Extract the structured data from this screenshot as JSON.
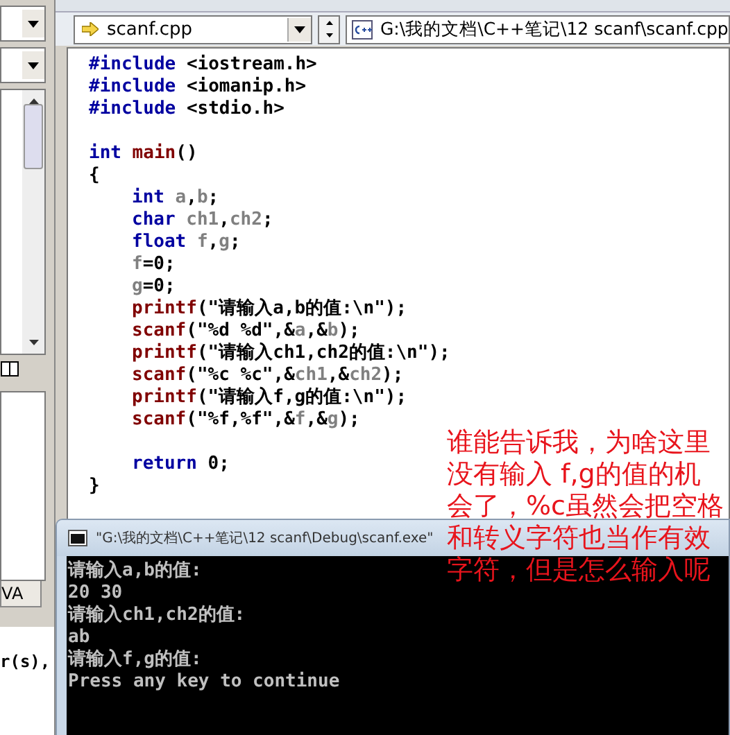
{
  "toolbar": {
    "file_combo": "scanf.cpp",
    "path": "G:\\我的文档\\C++笔记\\12 scanf\\scanf.cpp"
  },
  "editor": {
    "lines": [
      {
        "kind": "top",
        "tokens": [
          {
            "kind": "keyword",
            "text": "#include"
          },
          {
            "kind": "plain",
            "text": " <iostream.h>"
          }
        ]
      },
      {
        "kind": "top",
        "tokens": [
          {
            "kind": "keyword",
            "text": "#include"
          },
          {
            "kind": "plain",
            "text": " <iomanip.h>"
          }
        ]
      },
      {
        "kind": "top",
        "tokens": [
          {
            "kind": "keyword",
            "text": "#include"
          },
          {
            "kind": "plain",
            "text": " <stdio.h>"
          }
        ]
      },
      {
        "kind": "blank"
      },
      {
        "kind": "top",
        "tokens": [
          {
            "kind": "keyword",
            "text": "int"
          },
          {
            "kind": "function",
            "text": " main"
          },
          {
            "kind": "plain",
            "text": "()"
          }
        ]
      },
      {
        "kind": "top",
        "tokens": [
          {
            "kind": "plain",
            "text": "{"
          }
        ]
      },
      {
        "kind": "body",
        "tokens": [
          {
            "kind": "keyword",
            "text": "int"
          },
          {
            "kind": "ident",
            "text": " a"
          },
          {
            "kind": "plain",
            "text": ","
          },
          {
            "kind": "ident",
            "text": "b"
          },
          {
            "kind": "plain",
            "text": ";"
          }
        ]
      },
      {
        "kind": "body",
        "tokens": [
          {
            "kind": "keyword",
            "text": "char"
          },
          {
            "kind": "ident",
            "text": " ch1"
          },
          {
            "kind": "plain",
            "text": ","
          },
          {
            "kind": "ident",
            "text": "ch2"
          },
          {
            "kind": "plain",
            "text": ";"
          }
        ]
      },
      {
        "kind": "body",
        "tokens": [
          {
            "kind": "keyword",
            "text": "float"
          },
          {
            "kind": "ident",
            "text": " f"
          },
          {
            "kind": "plain",
            "text": ","
          },
          {
            "kind": "ident",
            "text": "g"
          },
          {
            "kind": "plain",
            "text": ";"
          }
        ]
      },
      {
        "kind": "body",
        "tokens": [
          {
            "kind": "ident",
            "text": "f"
          },
          {
            "kind": "plain",
            "text": "=0;"
          }
        ]
      },
      {
        "kind": "body",
        "tokens": [
          {
            "kind": "ident",
            "text": "g"
          },
          {
            "kind": "plain",
            "text": "=0;"
          }
        ]
      },
      {
        "kind": "body",
        "tokens": [
          {
            "kind": "function",
            "text": "printf"
          },
          {
            "kind": "plain",
            "text": "(\"请输入a,b的值:\\n\");"
          }
        ]
      },
      {
        "kind": "body",
        "tokens": [
          {
            "kind": "function",
            "text": "scanf"
          },
          {
            "kind": "plain",
            "text": "(\"%d %d\",&"
          },
          {
            "kind": "ident",
            "text": "a"
          },
          {
            "kind": "plain",
            "text": ",&"
          },
          {
            "kind": "ident",
            "text": "b"
          },
          {
            "kind": "plain",
            "text": ");"
          }
        ]
      },
      {
        "kind": "body",
        "tokens": [
          {
            "kind": "function",
            "text": "printf"
          },
          {
            "kind": "plain",
            "text": "(\"请输入ch1,ch2的值:\\n\");"
          }
        ]
      },
      {
        "kind": "body",
        "tokens": [
          {
            "kind": "function",
            "text": "scanf"
          },
          {
            "kind": "plain",
            "text": "(\"%c %c\",&"
          },
          {
            "kind": "ident",
            "text": "ch1"
          },
          {
            "kind": "plain",
            "text": ",&"
          },
          {
            "kind": "ident",
            "text": "ch2"
          },
          {
            "kind": "plain",
            "text": ");"
          }
        ]
      },
      {
        "kind": "body",
        "tokens": [
          {
            "kind": "function",
            "text": "printf"
          },
          {
            "kind": "plain",
            "text": "(\"请输入f,g的值:\\n\");"
          }
        ]
      },
      {
        "kind": "body",
        "tokens": [
          {
            "kind": "function",
            "text": "scanf"
          },
          {
            "kind": "plain",
            "text": "(\"%f,%f\",&"
          },
          {
            "kind": "ident",
            "text": "f"
          },
          {
            "kind": "plain",
            "text": ",&"
          },
          {
            "kind": "ident",
            "text": "g"
          },
          {
            "kind": "plain",
            "text": ");"
          }
        ]
      },
      {
        "kind": "blank"
      },
      {
        "kind": "body",
        "tokens": [
          {
            "kind": "keyword",
            "text": "return"
          },
          {
            "kind": "plain",
            "text": " 0;"
          }
        ]
      },
      {
        "kind": "top",
        "tokens": [
          {
            "kind": "plain",
            "text": "}"
          }
        ]
      }
    ]
  },
  "side_panel": {
    "tab_label": "VA",
    "output_text": "r(s),"
  },
  "console": {
    "title": "\"G:\\我的文档\\C++笔记\\12 scanf\\Debug\\scanf.exe\"",
    "lines": [
      "请输入a,b的值:",
      "20 30",
      "请输入ch1,ch2的值:",
      "ab",
      "请输入f,g的值:",
      "Press any key to continue"
    ]
  },
  "annotation": "谁能告诉我，为啥这里没有输入 f,g的值的机会了，%c虽然会把空格和转义字符也当作有效字符，但是怎么输入呢"
}
